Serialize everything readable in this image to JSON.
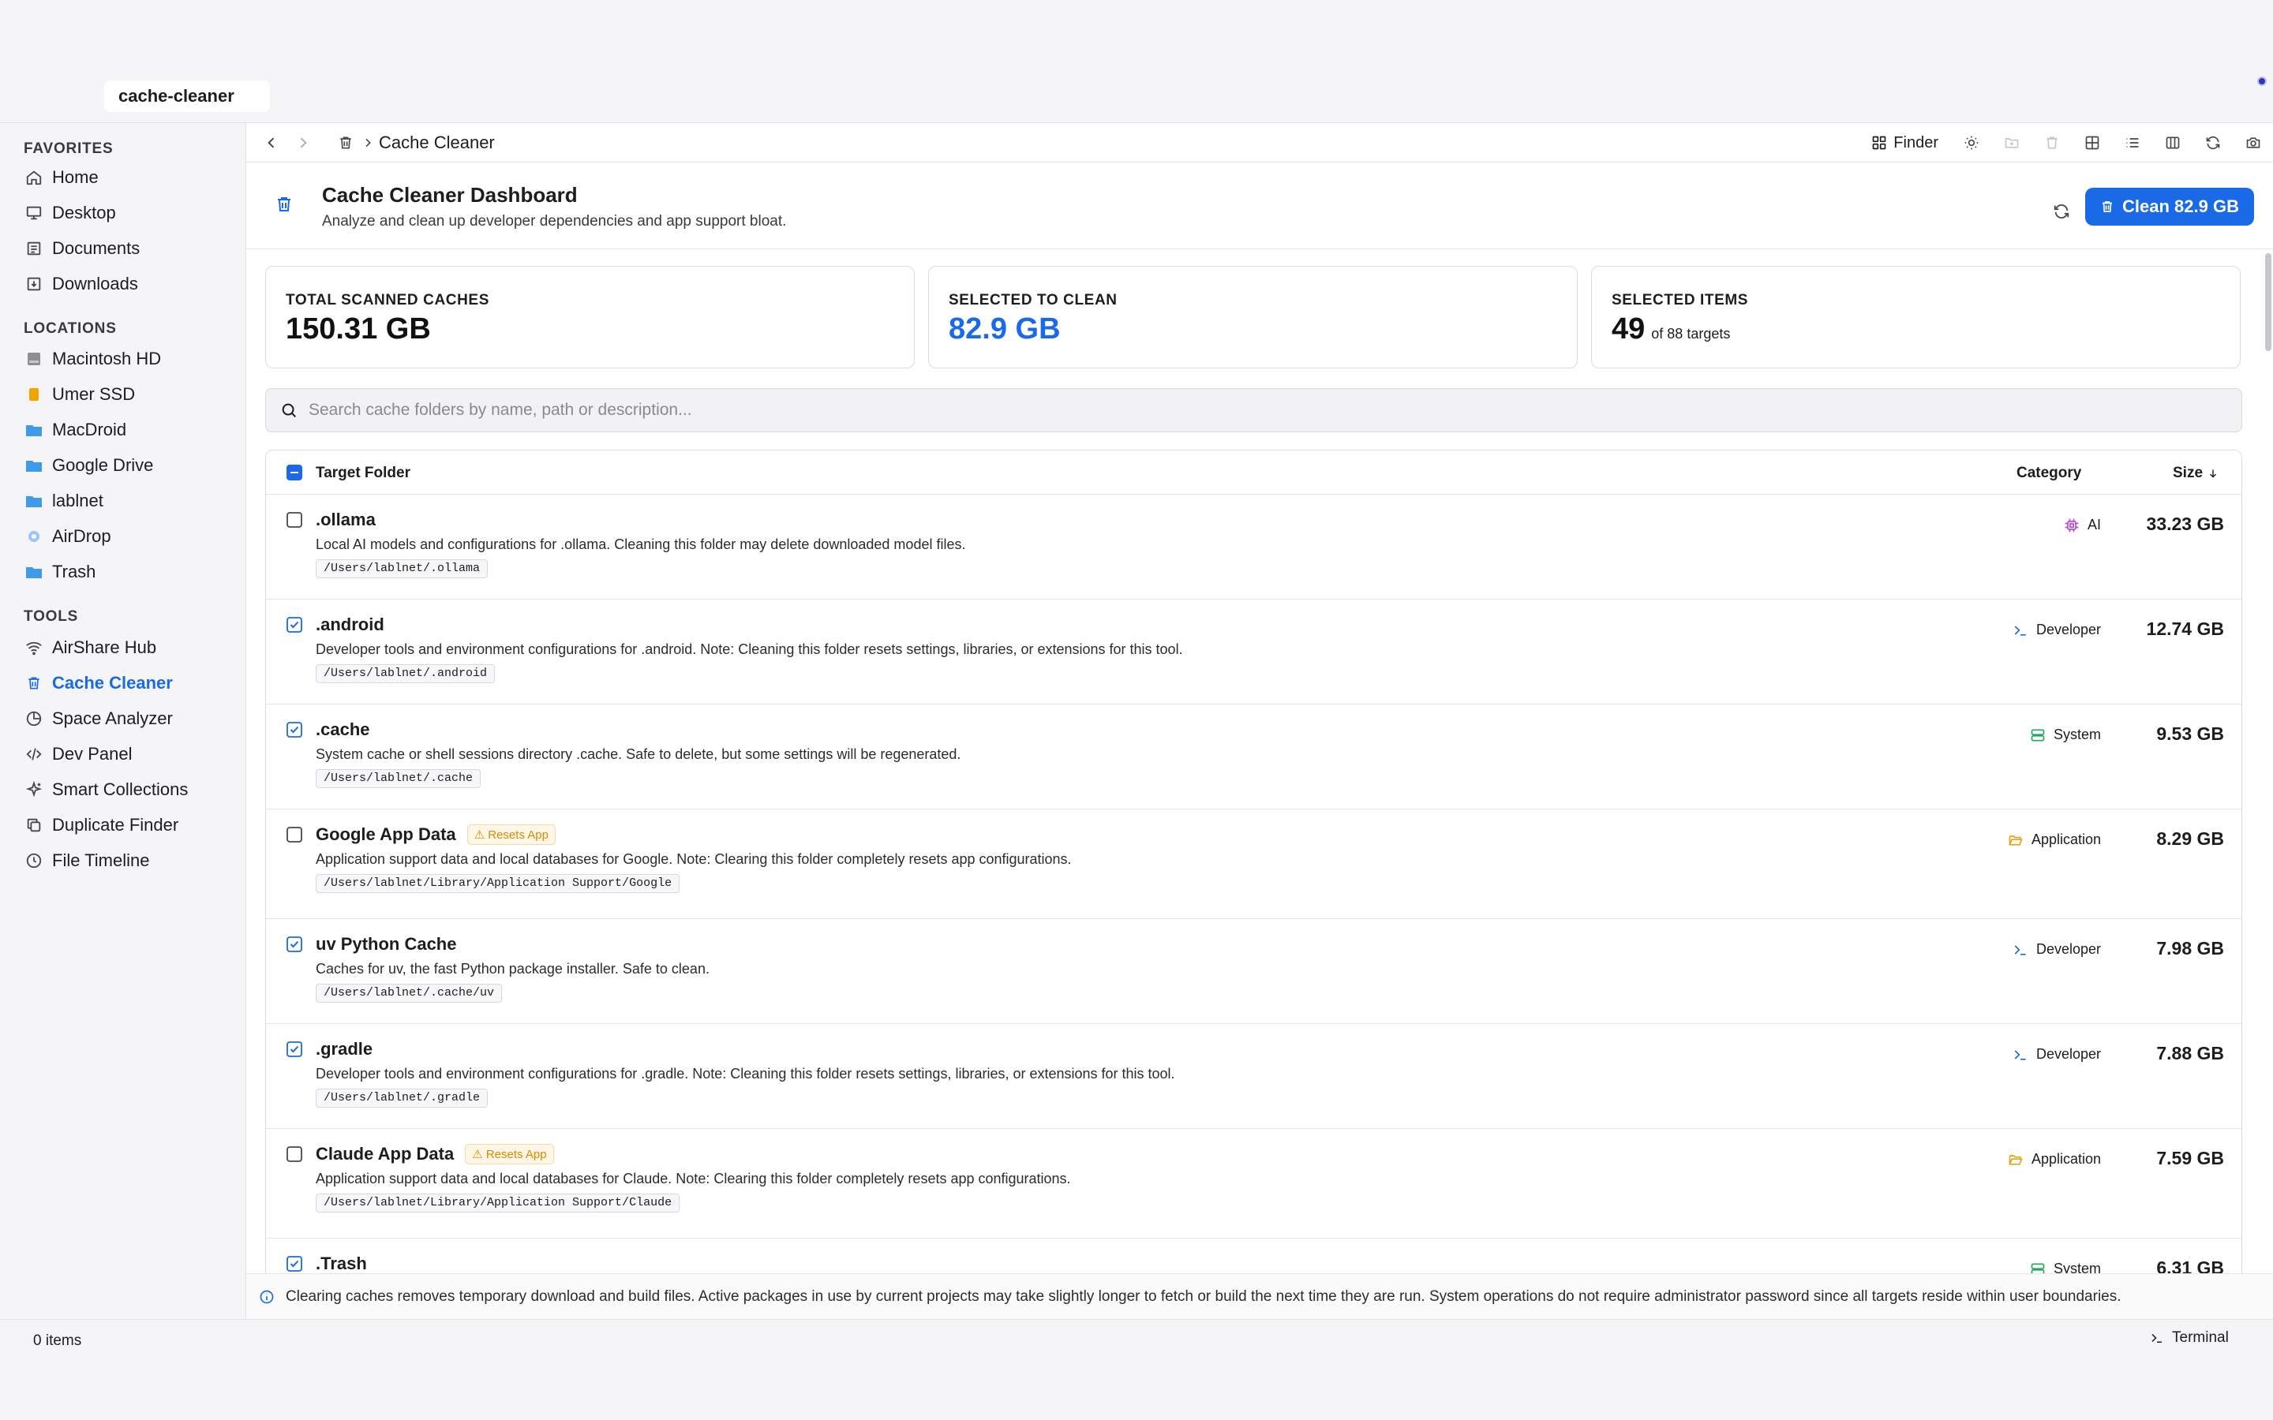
{
  "window": {
    "tab_title": "cache-cleaner"
  },
  "sidebar": {
    "favorites_heading": "FAVORITES",
    "favorites": [
      {
        "label": "Home",
        "icon": "home-icon"
      },
      {
        "label": "Desktop",
        "icon": "monitor-icon"
      },
      {
        "label": "Documents",
        "icon": "document-icon"
      },
      {
        "label": "Downloads",
        "icon": "download-icon"
      }
    ],
    "locations_heading": "LOCATIONS",
    "locations": [
      {
        "label": "Macintosh HD",
        "icon": "hard-drive-icon"
      },
      {
        "label": "Umer SSD",
        "icon": "external-drive-icon"
      },
      {
        "label": "MacDroid",
        "icon": "folder-icon"
      },
      {
        "label": "Google Drive",
        "icon": "folder-icon"
      },
      {
        "label": "lablnet",
        "icon": "folder-icon"
      },
      {
        "label": "AirDrop",
        "icon": "airdrop-icon"
      },
      {
        "label": "Trash",
        "icon": "folder-icon"
      }
    ],
    "tools_heading": "TOOLS",
    "tools": [
      {
        "label": "AirShare Hub",
        "icon": "wifi-icon"
      },
      {
        "label": "Cache Cleaner",
        "icon": "trash-icon",
        "active": true
      },
      {
        "label": "Space Analyzer",
        "icon": "pie-chart-icon"
      },
      {
        "label": "Dev Panel",
        "icon": "code-icon"
      },
      {
        "label": "Smart Collections",
        "icon": "sparkles-icon"
      },
      {
        "label": "Duplicate Finder",
        "icon": "copy-icon"
      },
      {
        "label": "File Timeline",
        "icon": "clock-icon"
      }
    ]
  },
  "toolbar": {
    "breadcrumb": "Cache Cleaner",
    "finder_label": "Finder"
  },
  "dashboard": {
    "title": "Cache Cleaner Dashboard",
    "subtitle": "Analyze and clean up developer dependencies and app support bloat.",
    "clean_button": "Clean 82.9 GB"
  },
  "stats": {
    "total_label": "TOTAL SCANNED CACHES",
    "total_value": "150.31 GB",
    "selected_label": "SELECTED TO CLEAN",
    "selected_value": "82.9 GB",
    "items_label": "SELECTED ITEMS",
    "items_value": "49",
    "items_suffix": "of 88 targets"
  },
  "search": {
    "placeholder": "Search cache folders by name, path or description..."
  },
  "table": {
    "col_folder": "Target Folder",
    "col_category": "Category",
    "col_size": "Size",
    "rows": [
      {
        "name": ".ollama",
        "checked": false,
        "badge": "",
        "desc": "Local AI models and configurations for .ollama. Cleaning this folder may delete downloaded model files.",
        "path": "/Users/lablnet/.ollama",
        "category": "AI",
        "cat_icon": "chip-icon",
        "cat_color": "#b44ad6",
        "size": "33.23 GB"
      },
      {
        "name": ".android",
        "checked": true,
        "badge": "",
        "desc": "Developer tools and environment configurations for .android. Note: Cleaning this folder resets settings, libraries, or extensions for this tool.",
        "path": "/Users/lablnet/.android",
        "category": "Developer",
        "cat_icon": "terminal-icon",
        "cat_color": "#1a6ae8",
        "size": "12.74 GB"
      },
      {
        "name": ".cache",
        "checked": true,
        "badge": "",
        "desc": "System cache or shell sessions directory .cache. Safe to delete, but some settings will be regenerated.",
        "path": "/Users/lablnet/.cache",
        "category": "System",
        "cat_icon": "server-icon",
        "cat_color": "#22a85a",
        "size": "9.53 GB"
      },
      {
        "name": "Google App Data",
        "checked": false,
        "badge": "⚠ Resets App",
        "desc": "Application support data and local databases for Google. Note: Clearing this folder completely resets app configurations.",
        "path": "/Users/lablnet/Library/Application Support/Google",
        "category": "Application",
        "cat_icon": "folder-open-icon",
        "cat_color": "#e8a317",
        "size": "8.29 GB"
      },
      {
        "name": "uv Python Cache",
        "checked": true,
        "badge": "",
        "desc": "Caches for uv, the fast Python package installer. Safe to clean.",
        "path": "/Users/lablnet/.cache/uv",
        "category": "Developer",
        "cat_icon": "terminal-icon",
        "cat_color": "#1a6ae8",
        "size": "7.98 GB"
      },
      {
        "name": ".gradle",
        "checked": true,
        "badge": "",
        "desc": "Developer tools and environment configurations for .gradle. Note: Cleaning this folder resets settings, libraries, or extensions for this tool.",
        "path": "/Users/lablnet/.gradle",
        "category": "Developer",
        "cat_icon": "terminal-icon",
        "cat_color": "#1a6ae8",
        "size": "7.88 GB"
      },
      {
        "name": "Claude App Data",
        "checked": false,
        "badge": "⚠ Resets App",
        "desc": "Application support data and local databases for Claude. Note: Clearing this folder completely resets app configurations.",
        "path": "/Users/lablnet/Library/Application Support/Claude",
        "category": "Application",
        "cat_icon": "folder-open-icon",
        "cat_color": "#e8a317",
        "size": "7.59 GB"
      },
      {
        "name": ".Trash",
        "checked": true,
        "badge": "",
        "desc": "",
        "path": "",
        "category": "System",
        "cat_icon": "server-icon",
        "cat_color": "#22a85a",
        "size": "6.31 GB"
      }
    ]
  },
  "info_note": "Clearing caches removes temporary download and build files. Active packages in use by current projects may take slightly longer to fetch or build the next time they are run. System operations do not require administrator password since all targets reside within user boundaries.",
  "statusbar": {
    "items_count": "0 items",
    "terminal_label": "Terminal"
  },
  "colors": {
    "accent": "#1a6ae8",
    "warning": "#d98a00",
    "developer": "#1a6ae8",
    "system": "#22a85a",
    "application": "#e8a317",
    "ai": "#b44ad6"
  }
}
